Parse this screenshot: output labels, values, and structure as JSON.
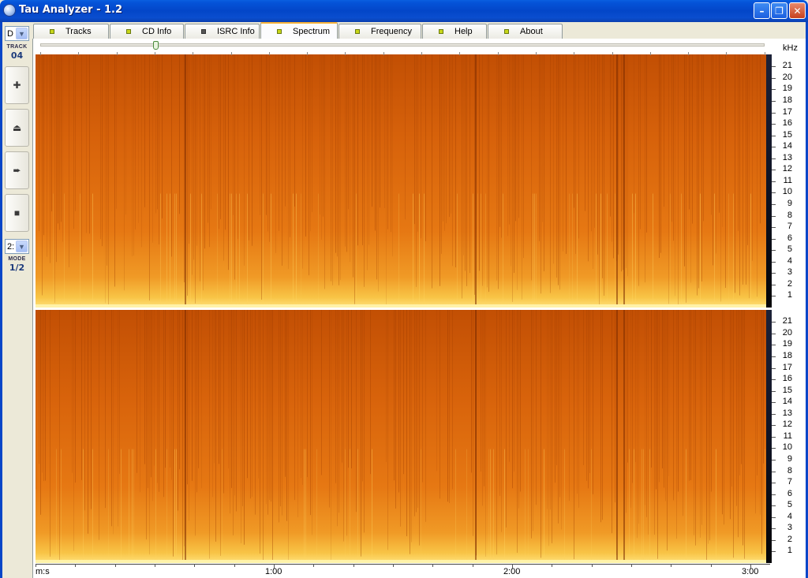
{
  "window": {
    "title": "Tau Analyzer - 1.2",
    "min_glyph": "–",
    "max_glyph": "❐",
    "close_glyph": "✕"
  },
  "left_panel": {
    "drive_value": "D",
    "track_caption": "TRACK",
    "track_value": "04",
    "mode_select_value": "2:",
    "mode_caption": "MODE",
    "mode_value": "1/2",
    "buttons": [
      {
        "name": "add-icon",
        "glyph": "✚"
      },
      {
        "name": "eject-icon",
        "glyph": "⏏"
      },
      {
        "name": "play-icon",
        "glyph": "➨"
      },
      {
        "name": "stop-icon",
        "glyph": "■"
      }
    ]
  },
  "tabs": [
    {
      "label": "Tracks",
      "led": "green"
    },
    {
      "label": "CD Info",
      "led": "green"
    },
    {
      "label": "ISRC Info",
      "led": "gray"
    },
    {
      "label": "Spectrum",
      "led": "green",
      "active": true
    },
    {
      "label": "Frequency",
      "led": "green"
    },
    {
      "label": "Help",
      "led": "green"
    },
    {
      "label": "About",
      "led": "green"
    }
  ],
  "spectrum": {
    "freq_unit": "kHz",
    "freq_labels": [
      "21",
      "20",
      "19",
      "18",
      "17",
      "16",
      "15",
      "14",
      "13",
      "12",
      "11",
      "10",
      "9",
      "8",
      "7",
      "6",
      "5",
      "4",
      "3",
      "2",
      "1"
    ],
    "time_axis_label": "m:s",
    "time_labels": [
      "1:00",
      "2:00",
      "3:00"
    ],
    "colors": {
      "low": "#c85a07",
      "mid": "#e06d10",
      "high": "#ffd85c",
      "colorbar": "#101425"
    }
  }
}
